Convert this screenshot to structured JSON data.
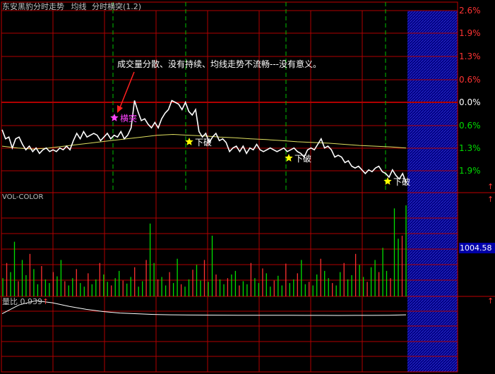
{
  "header": {
    "title": "东安黑豹分时走势",
    "avg_label": "均线",
    "indicator": "分时横突(1.2)"
  },
  "annotation": "成交量分散、没有持续、均线走势不流畅---没有意义。",
  "markers": [
    "横突",
    "下破",
    "下破",
    "下破"
  ],
  "volume_panel": {
    "label": "VOL-COLOR",
    "value": "1004.58"
  },
  "ratio_panel": {
    "label": "量比",
    "value": "0.939"
  },
  "chart_data": {
    "type": "line",
    "y_axis_labels": [
      "2.6%",
      "1.9%",
      "1.3%",
      "0.6%",
      "0.0%",
      "0.6%",
      "1.3%",
      "1.9%"
    ],
    "price_ylim": [
      -2.3,
      2.6
    ],
    "series": [
      {
        "values": [
          -0.75,
          -1.0,
          -0.95,
          -1.25,
          -1.0,
          -0.95,
          -1.15,
          -1.3,
          -1.2,
          -1.35,
          -1.25,
          -1.4,
          -1.3,
          -1.25,
          -1.35,
          -1.3,
          -1.35,
          -1.25,
          -1.3,
          -1.2,
          -1.3,
          -1.05,
          -0.85,
          -1.0,
          -0.8,
          -0.95,
          -0.9,
          -0.85,
          -0.9,
          -1.05,
          -0.95,
          -0.85,
          -1.0,
          -0.9,
          -0.95,
          -0.8,
          -1.0,
          -0.9,
          -0.7,
          0.05,
          -0.25,
          -0.5,
          -0.45,
          -0.6,
          -0.7,
          -0.55,
          -0.7,
          -0.45,
          -0.3,
          -0.2,
          0.05,
          0.0,
          -0.05,
          -0.2,
          0.0,
          -0.25,
          -0.35,
          -0.2,
          -0.8,
          -0.95,
          -0.85,
          -1.1,
          -0.95,
          -0.85,
          -1.05,
          -1.0,
          -1.1,
          -1.35,
          -1.25,
          -1.2,
          -1.35,
          -1.2,
          -1.4,
          -1.25,
          -1.3,
          -1.15,
          -1.3,
          -1.35,
          -1.3,
          -1.25,
          -1.3,
          -1.35,
          -1.3,
          -1.25,
          -1.35,
          -1.3,
          -1.25,
          -1.35,
          -1.4,
          -1.5,
          -1.3,
          -1.25,
          -1.3,
          -1.15,
          -1.0,
          -1.25,
          -1.2,
          -1.3,
          -1.5,
          -1.45,
          -1.5,
          -1.65,
          -1.6,
          -1.75,
          -1.8,
          -1.75,
          -1.85,
          -1.95,
          -1.85,
          -1.9,
          -1.8,
          -1.75,
          -1.9,
          -1.95,
          -2.05,
          -1.85,
          -2.0,
          -2.1,
          -1.95,
          -2.2
        ]
      },
      {
        "values": [
          -1.2,
          -1.25,
          -1.28,
          -1.25,
          -1.2,
          -1.15,
          -1.1,
          -1.05,
          -1.0,
          -0.95,
          -0.9,
          -0.88,
          -0.9,
          -0.92,
          -0.95,
          -0.97,
          -1.0,
          -1.02,
          -1.05,
          -1.08,
          -1.1,
          -1.12,
          -1.15,
          -1.18,
          -1.2,
          -1.22,
          -1.25
        ]
      }
    ],
    "volume": [
      30,
      55,
      40,
      90,
      25,
      60,
      35,
      70,
      45,
      20,
      50,
      28,
      22,
      40,
      33,
      60,
      25,
      18,
      30,
      45,
      22,
      16,
      38,
      20,
      28,
      55,
      36,
      24,
      18,
      30,
      42,
      26,
      21,
      32,
      48,
      16,
      25,
      60,
      120,
      55,
      28,
      32,
      18,
      40,
      22,
      62,
      20,
      16,
      28,
      44,
      52,
      26,
      60,
      24,
      100,
      36,
      28,
      20,
      30,
      36,
      42,
      18,
      25,
      20,
      55,
      30,
      22,
      46,
      38,
      16,
      26,
      34,
      18,
      54,
      22,
      28,
      38,
      60,
      20,
      24,
      18,
      36,
      62,
      42,
      30,
      22,
      18,
      40,
      55,
      28,
      35,
      70,
      52,
      32,
      24,
      48,
      60,
      40,
      80,
      42,
      30,
      145,
      95,
      100,
      150
    ],
    "ratio": [
      8.0,
      9.2,
      9.8,
      9.5,
      9.0,
      8.6,
      8.3,
      8.1,
      8.0,
      7.9,
      7.85,
      7.83,
      7.82,
      7.81,
      7.8,
      7.8,
      7.79,
      7.79,
      7.78,
      7.78,
      7.77,
      7.78,
      7.78,
      7.8,
      7.85
    ]
  }
}
